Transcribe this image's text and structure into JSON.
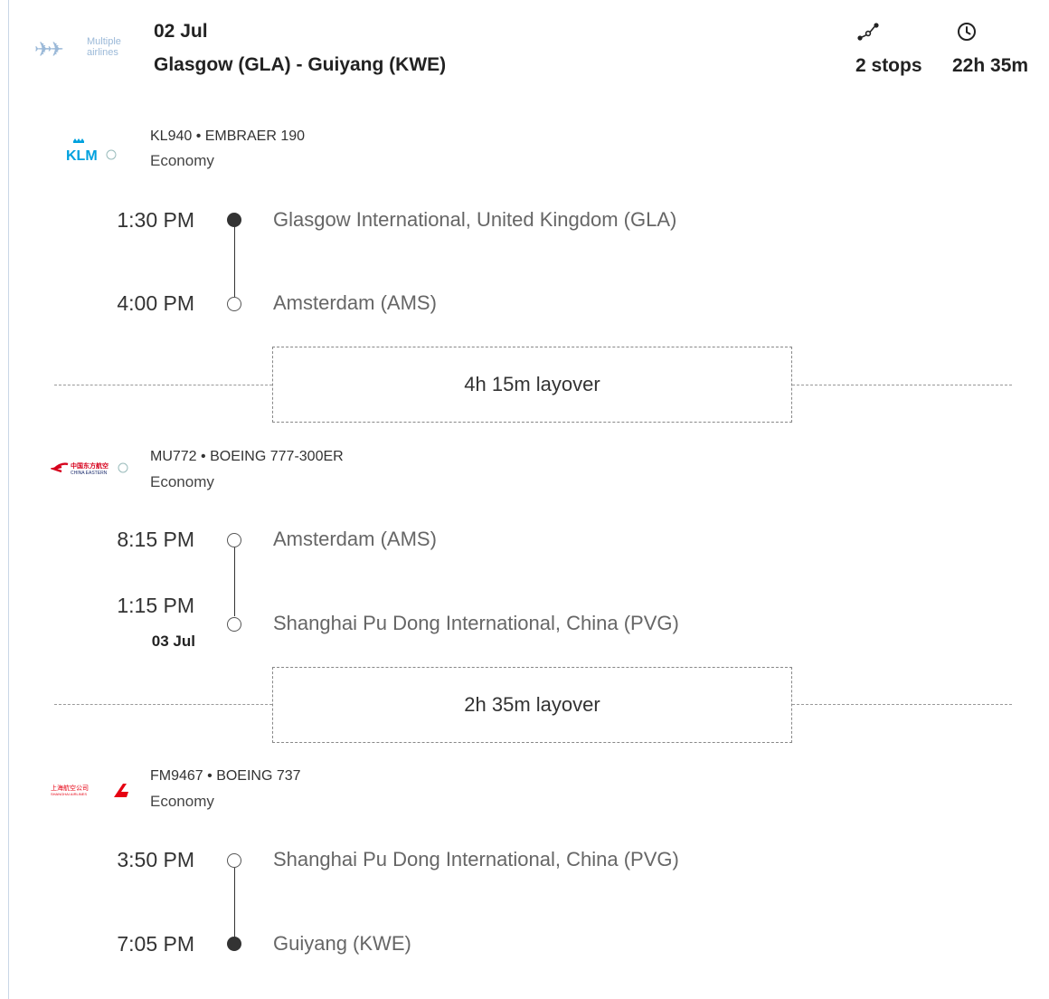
{
  "header": {
    "airline_label": "Multiple airlines",
    "airline_label_line1": "Multiple",
    "airline_label_line2": "airlines",
    "date": "02 Jul",
    "route": "Glasgow (GLA) - Guiyang (KWE)",
    "stops": "2 stops",
    "duration": "22h 35m",
    "stops_icon": "route-stops-icon",
    "duration_icon": "clock-icon"
  },
  "segments": [
    {
      "airline_logo": "klm-logo",
      "airline_logo_text": "KLM",
      "flight": "KL940 • EMBRAER 190",
      "cabin": "Economy",
      "depart_time": "1:30 PM",
      "depart_place": "Glasgow International, United Kingdom (GLA)",
      "arrive_time": "4:00 PM",
      "arrive_place": "Amsterdam (AMS)",
      "arrive_date": ""
    },
    {
      "airline_logo": "china-eastern-logo",
      "airline_logo_text": "中国东方航空",
      "flight": "MU772 • BOEING 777-300ER",
      "cabin": "Economy",
      "depart_time": "8:15 PM",
      "depart_place": "Amsterdam (AMS)",
      "arrive_time": "1:15 PM",
      "arrive_place": "Shanghai Pu Dong International, China (PVG)",
      "arrive_date": "03 Jul"
    },
    {
      "airline_logo": "shanghai-airlines-logo",
      "airline_logo_text": "上海航空公司",
      "flight": "FM9467 • BOEING 737",
      "cabin": "Economy",
      "depart_time": "3:50 PM",
      "depart_place": "Shanghai Pu Dong International, China (PVG)",
      "arrive_time": "7:05 PM",
      "arrive_place": "Guiyang (KWE)",
      "arrive_date": ""
    }
  ],
  "layovers": [
    "4h 15m layover",
    "2h 35m layover"
  ],
  "colors": {
    "text": "#222222",
    "muted": "#666666",
    "logo_blue": "#9bb9d8",
    "klm_blue": "#00a1de",
    "china_eastern_red": "#d6001c",
    "shanghai_red": "#e60012"
  }
}
